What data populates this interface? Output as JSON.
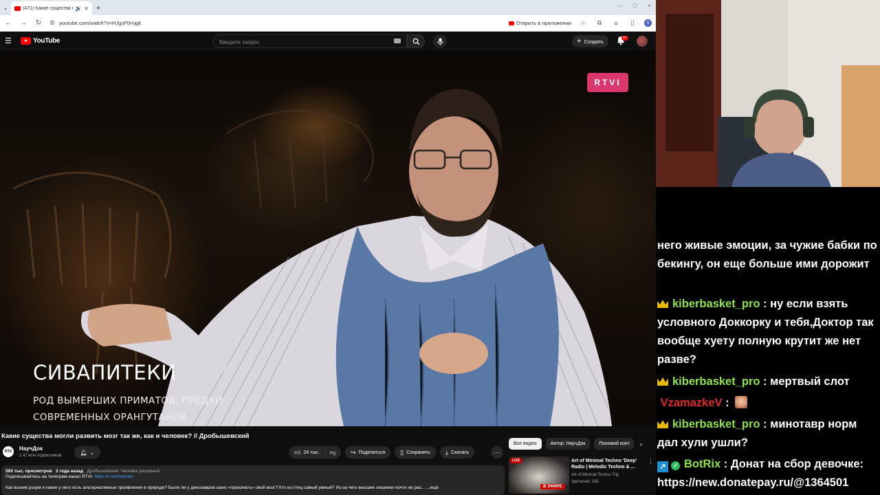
{
  "browser": {
    "tab_title": "(471) Какие существа могли",
    "url": "youtube.com/watch?v=HJgsF0rnjgk",
    "open_in_app": "Открыть в приложении",
    "profile_letter": "S"
  },
  "youtube": {
    "logo": "YouTube",
    "search_placeholder": "Введите запрос",
    "create_label": "Создать",
    "notifications_badge": "9+"
  },
  "video": {
    "overlay_brand": "RTVI",
    "overlay_title": "СИВАПИТЕКИ",
    "overlay_subtitle_1": "РОД ВЫМЕРШИХ ПРИМАТОВ, ПРЕДКИ",
    "overlay_subtitle_2": "СОВРЕМЕННЫХ ОРАНГУТАНОВ",
    "title": "Какие существа могли развить мозг так же, как и человек? // Дробышевский",
    "channel_avatar_text": "RTS",
    "channel_name": "НаучДок",
    "channel_subs": "1,47 млн подписчиков",
    "likes": "24 тыс.",
    "share_label": "Поделиться",
    "save_label": "Сохранить",
    "download_label": "Скачать"
  },
  "description": {
    "views": "593 тыс. просмотров",
    "date": "2 года назад",
    "tags": "Дробышевский. Человек разумный",
    "subscribe_text": "Подписывайтесь на телеграм-канал RTVI:",
    "link": "https://t.me/rtvimain",
    "body": "Как возник разум и какие у него есть альтернативные проявления в природе? Были ли у динозавров шанс «прокачать» свой мозг? Кто из птиц самый умный? Из-за чего высшие хищники почти не раз... ...ещё"
  },
  "sidebar": {
    "chips": [
      "Все видео",
      "Автор: НаучДок",
      "Похожий конт"
    ],
    "rec": {
      "live": "LIVE",
      "on_air": "В ЭФИРЕ",
      "title": "Art of Minimal Techno 'Deep' Radio | Melodic Techno & ...",
      "channel": "Art of Minimal Techno Trip",
      "viewers": "Зрителей: 165"
    }
  },
  "chat": {
    "messages": [
      {
        "user": "",
        "text": "него живые эмоции, за чужие бабки по бекингу, он еще больше ими дорожит"
      },
      {
        "user": "kiberbasket_pro",
        "text": " : ну если взять условного Доккорку и тебя,Доктор так вообще хуету полную крутит же нет разве?"
      },
      {
        "user": "kiberbasket_pro",
        "text": " : мертвый слот"
      },
      {
        "user": "VzamazkeV",
        "text": " : "
      },
      {
        "user": "kiberbasket_pro",
        "text": " : минотавр норм дал хули ушли?"
      },
      {
        "user": "BotRix",
        "text": " : Донат на сбор девочке: https://new.donatepay.ru/@1364501"
      }
    ]
  },
  "colors": {
    "youtube_red": "#ff0000",
    "rtvi_pink": "#d9376e",
    "chat_username_green": "#8ee34d",
    "chat_username_red": "#e02a2a",
    "link_blue": "#3ea6ff"
  }
}
